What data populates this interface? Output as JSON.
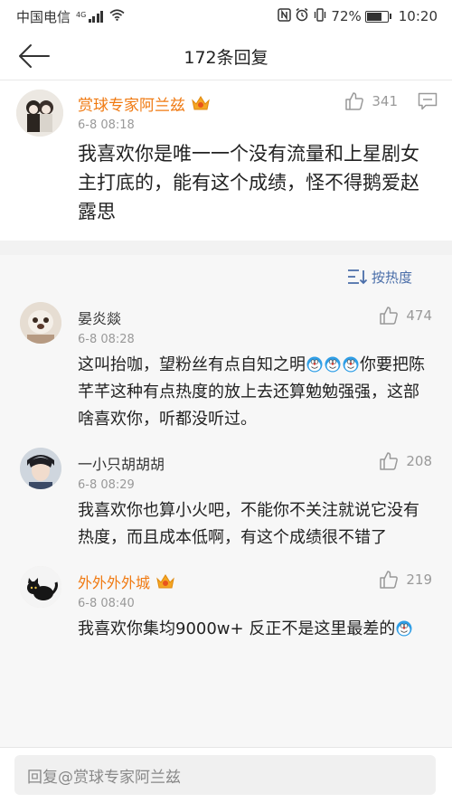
{
  "status_bar": {
    "carrier": "中国电信",
    "network": "4G",
    "nfc_icon": "nfc-icon",
    "alarm_icon": "alarm-icon",
    "vibrate_icon": "vibrate-icon",
    "battery_percent": "72%",
    "battery_level": 0.72,
    "time": "10:20"
  },
  "nav": {
    "title": "172条回复",
    "back_icon": "back-arrow-icon"
  },
  "main_comment": {
    "user": "赏球专家阿兰兹",
    "badge_icon": "vip-crown-icon",
    "time": "6-8 08:18",
    "text": "我喜欢你是唯一一个没有流量和上星剧女主打底的，能有这个成绩，怪不得鹅爱赵露思",
    "likes": "341"
  },
  "sort": {
    "label": "按热度"
  },
  "replies": [
    {
      "user": "晏炎燚",
      "vip": false,
      "time": "6-8 08:28",
      "likes": "474",
      "text_before": "这叫抬咖，望粉丝有点自知之明",
      "emoji_count": 3,
      "text_after": "你要把陈芊芊这种有点热度的放上去还算勉勉强强，这部啥喜欢你，听都没听过。"
    },
    {
      "user": "一小只胡胡胡",
      "vip": false,
      "time": "6-8 08:29",
      "likes": "208",
      "text": "我喜欢你也算小火吧，不能你不关注就说它没有热度，而且成本低啊，有这个成绩很不错了"
    },
    {
      "user": "外外外外城",
      "vip": true,
      "time": "6-8 08:40",
      "likes": "219",
      "text": "我喜欢你集均9000w+ 反正不是这里最差的",
      "emoji_count": 1
    }
  ],
  "input": {
    "placeholder": "回复@赏球专家阿兰兹"
  },
  "colors": {
    "vip_name": "#f07a12",
    "link_blue": "#4a6ea9",
    "meta_gray": "#999999"
  }
}
